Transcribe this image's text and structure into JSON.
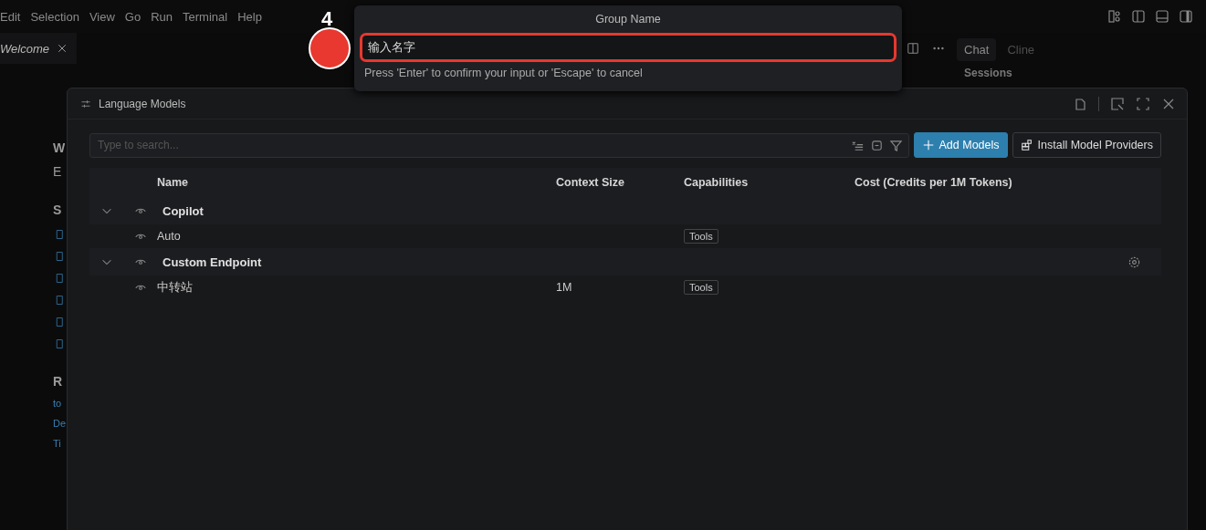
{
  "menu_bar": [
    "Edit",
    "Selection",
    "View",
    "Go",
    "Run",
    "Terminal",
    "Help"
  ],
  "editor_tabs": [
    {
      "label": "Welcome",
      "selected": true
    }
  ],
  "welcome_fragments": [
    {
      "kind": "heading",
      "text": "W"
    },
    {
      "kind": "subtitle",
      "text": "E"
    },
    {
      "kind": "section",
      "text": "S"
    },
    {
      "kind": "section",
      "text": "R"
    },
    {
      "kind": "link",
      "text": "to"
    },
    {
      "kind": "link",
      "text": "De"
    },
    {
      "kind": "link",
      "text": "Ti"
    }
  ],
  "chat_panel": {
    "tabs": [
      {
        "label": "Chat",
        "selected": true
      },
      {
        "label": "Cline",
        "selected": false
      }
    ],
    "section": "Sessions"
  },
  "models_dialog": {
    "title": "Language Models",
    "search": {
      "placeholder": "Type to search..."
    },
    "buttons": [
      {
        "label": "Add Models",
        "kind": "primary"
      },
      {
        "label": "Install Model Providers",
        "kind": "secondary"
      }
    ],
    "columns": [
      "Name",
      "Context Size",
      "Capabilities",
      "Cost (Credits per 1M Tokens)"
    ],
    "groups": [
      {
        "name": "Copilot",
        "expanded": true,
        "configurable": false,
        "models": [
          {
            "name": "Auto",
            "capabilities": [
              "Tools"
            ]
          }
        ]
      },
      {
        "name": "Custom Endpoint",
        "expanded": true,
        "configurable": true,
        "models": [
          {
            "name": "中转站",
            "context_size": "1M",
            "capabilities": [
              "Tools"
            ]
          }
        ]
      }
    ]
  },
  "quick_input": {
    "title": "Group Name",
    "value": "输入名字",
    "hint": "Press 'Enter' to confirm your input or 'Escape' to cancel"
  },
  "annotation": {
    "label": "4"
  }
}
